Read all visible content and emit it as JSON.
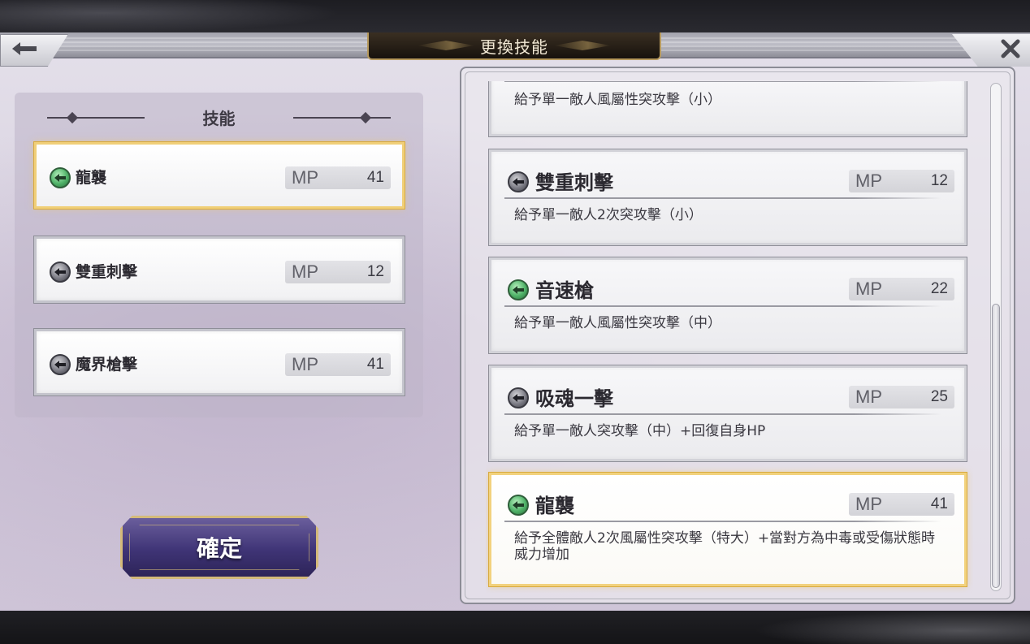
{
  "header": {
    "title": "更換技能",
    "back_icon": "arrow-left-icon",
    "close_icon": "close-icon"
  },
  "equipped": {
    "title": "技能",
    "slots": [
      {
        "name": "龍襲",
        "mp_label": "MP",
        "mp": "41",
        "icon": "green",
        "selected": true
      },
      {
        "name": "雙重刺擊",
        "mp_label": "MP",
        "mp": "12",
        "icon": "gray",
        "selected": false
      },
      {
        "name": "魔界槍擊",
        "mp_label": "MP",
        "mp": "41",
        "icon": "gray",
        "selected": false
      }
    ]
  },
  "confirm_label": "確定",
  "skill_list": [
    {
      "name": "",
      "mp_label": "",
      "mp": "",
      "desc": "給予單一敵人風屬性突攻擊（小）",
      "partial": true
    },
    {
      "name": "雙重刺擊",
      "mp_label": "MP",
      "mp": "12",
      "desc": "給予單一敵人2次突攻擊（小）",
      "icon": "gray"
    },
    {
      "name": "音速槍",
      "mp_label": "MP",
      "mp": "22",
      "desc": "給予單一敵人風屬性突攻擊（中）",
      "icon": "green"
    },
    {
      "name": "吸魂一擊",
      "mp_label": "MP",
      "mp": "25",
      "desc": "給予單一敵人突攻擊（中）+回復自身HP",
      "icon": "gray"
    },
    {
      "name": "龍襲",
      "mp_label": "MP",
      "mp": "41",
      "desc": "給予全體敵人2次風屬性突攻擊（特大）+當對方為中毒或受傷狀態時威力增加",
      "icon": "green",
      "selected": true
    }
  ],
  "colors": {
    "selected_border": "#f0cf78",
    "title_plate": "#17120d",
    "confirm_button": "#3f3476"
  },
  "scroll": {
    "position": 0.75
  }
}
